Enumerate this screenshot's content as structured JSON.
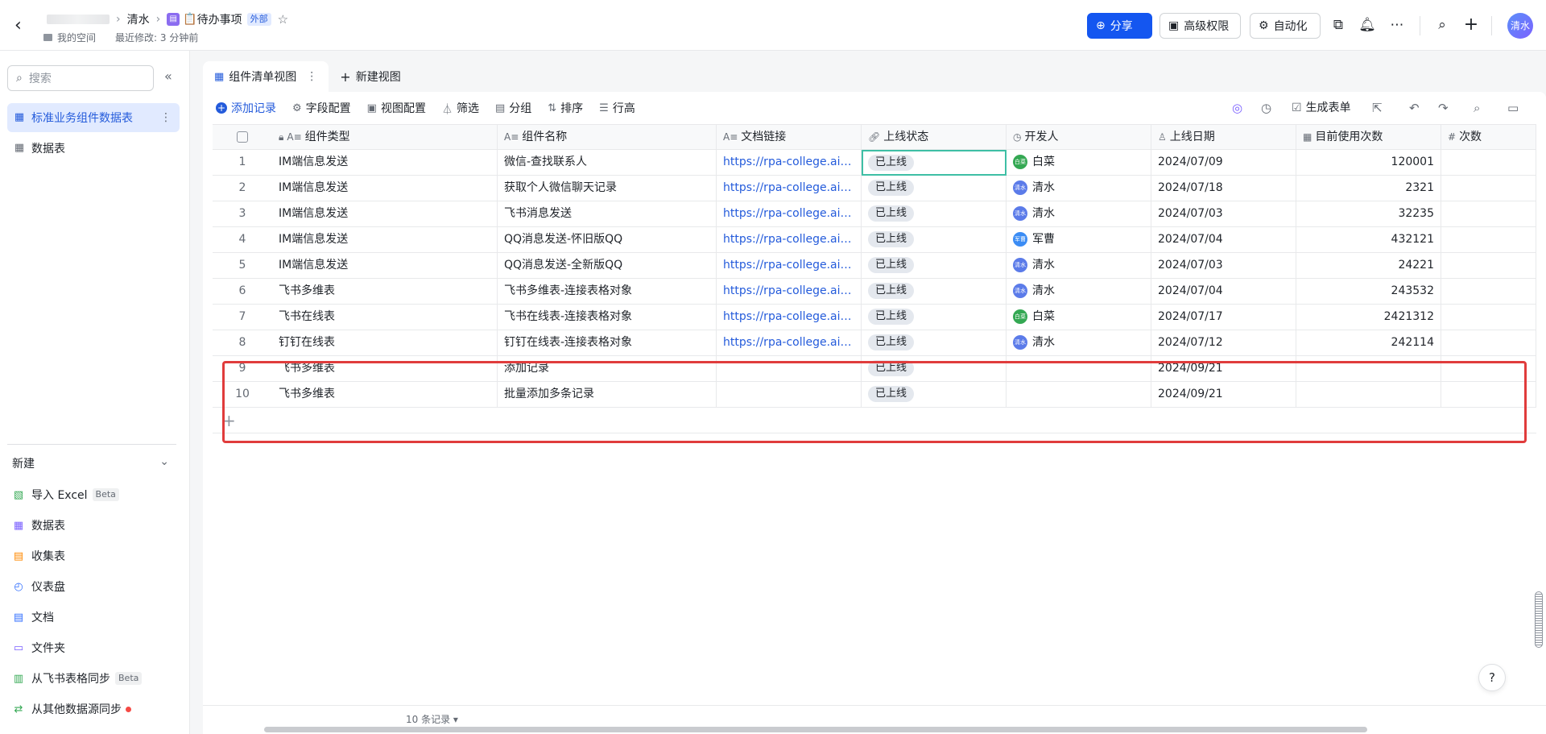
{
  "header": {
    "breadcrumb": {
      "parent": "清水",
      "doc_icon": "📋",
      "title": "待办事项",
      "badge": "外部"
    },
    "subline": {
      "space": "我的空间",
      "modified": "最近修改: 3 分钟前"
    },
    "buttons": {
      "share": "分享",
      "permission": "高级权限",
      "automation": "自动化"
    },
    "avatar": "清水"
  },
  "sidebar": {
    "search_placeholder": "搜索",
    "items": [
      {
        "label": "标准业务组件数据表",
        "active": true
      },
      {
        "label": "数据表",
        "active": false
      }
    ],
    "new_section": {
      "title": "新建",
      "items": [
        {
          "label": "导入 Excel",
          "badge": "Beta",
          "icon": "excel-icon",
          "color": "#34a853"
        },
        {
          "label": "数据表",
          "icon": "table-icon",
          "color": "#7b61ff"
        },
        {
          "label": "收集表",
          "icon": "form-icon",
          "color": "#ff8800"
        },
        {
          "label": "仪表盘",
          "icon": "dashboard-icon",
          "color": "#3370ff"
        },
        {
          "label": "文档",
          "icon": "doc-icon",
          "color": "#3370ff"
        },
        {
          "label": "文件夹",
          "icon": "folder-icon",
          "color": "#7b61ff"
        },
        {
          "label": "从飞书表格同步",
          "badge": "Beta",
          "icon": "sheet-sync-icon",
          "color": "#34a853"
        },
        {
          "label": "从其他数据源同步",
          "icon": "datasource-sync-icon",
          "color": "#34a853"
        }
      ]
    }
  },
  "tabs": [
    {
      "label": "组件清单视图",
      "active": true
    },
    {
      "label": "新建视图",
      "active": false
    }
  ],
  "toolbar": {
    "add_record": "添加记录",
    "field_config": "字段配置",
    "view_config": "视图配置",
    "filter": "筛选",
    "group": "分组",
    "sort": "排序",
    "row_height": "行高",
    "generate_form": "生成表单"
  },
  "table": {
    "columns": [
      "组件类型",
      "组件名称",
      "文档链接",
      "上线状态",
      "开发人",
      "上线日期",
      "目前使用次数",
      "次数"
    ],
    "rows": [
      {
        "idx": "1",
        "type": "IM端信息发送",
        "name": "微信-查找联系人",
        "link": "https://rpa-college.ai-in...",
        "status": "已上线",
        "dev": "白菜",
        "dev_short": "白菜",
        "dev_color": "green",
        "date": "2024/07/09",
        "count": "120001"
      },
      {
        "idx": "2",
        "type": "IM端信息发送",
        "name": "获取个人微信聊天记录",
        "link": "https://rpa-college.ai-in...",
        "status": "已上线",
        "dev": "清水",
        "dev_short": "清水",
        "dev_color": "blue",
        "date": "2024/07/18",
        "count": "2321"
      },
      {
        "idx": "3",
        "type": "IM端信息发送",
        "name": "飞书消息发送",
        "link": "https://rpa-college.ai-in...",
        "status": "已上线",
        "dev": "清水",
        "dev_short": "清水",
        "dev_color": "blue",
        "date": "2024/07/03",
        "count": "32235"
      },
      {
        "idx": "4",
        "type": "IM端信息发送",
        "name": "QQ消息发送-怀旧版QQ",
        "link": "https://rpa-college.ai-in...",
        "status": "已上线",
        "dev": "军曹",
        "dev_short": "军曹",
        "dev_color": "cyan",
        "date": "2024/07/04",
        "count": "432121"
      },
      {
        "idx": "5",
        "type": "IM端信息发送",
        "name": "QQ消息发送-全新版QQ",
        "link": "https://rpa-college.ai-in...",
        "status": "已上线",
        "dev": "清水",
        "dev_short": "清水",
        "dev_color": "blue",
        "date": "2024/07/03",
        "count": "24221"
      },
      {
        "idx": "6",
        "type": "飞书多维表",
        "name": "飞书多维表-连接表格对象",
        "link": "https://rpa-college.ai-in...",
        "status": "已上线",
        "dev": "清水",
        "dev_short": "清水",
        "dev_color": "blue",
        "date": "2024/07/04",
        "count": "243532"
      },
      {
        "idx": "7",
        "type": "飞书在线表",
        "name": "飞书在线表-连接表格对象",
        "link": "https://rpa-college.ai-in...",
        "status": "已上线",
        "dev": "白菜",
        "dev_short": "白菜",
        "dev_color": "green",
        "date": "2024/07/17",
        "count": "2421312"
      },
      {
        "idx": "8",
        "type": "钉钉在线表",
        "name": "钉钉在线表-连接表格对象",
        "link": "https://rpa-college.ai-in...",
        "status": "已上线",
        "dev": "清水",
        "dev_short": "清水",
        "dev_color": "blue",
        "date": "2024/07/12",
        "count": "242114"
      },
      {
        "idx": "9",
        "type": "飞书多维表",
        "name": "添加记录",
        "link": "",
        "status": "已上线",
        "dev": "",
        "dev_short": "",
        "dev_color": "",
        "date": "2024/09/21",
        "count": ""
      },
      {
        "idx": "10",
        "type": "飞书多维表",
        "name": "批量添加多条记录",
        "link": "",
        "status": "已上线",
        "dev": "",
        "dev_short": "",
        "dev_color": "",
        "date": "2024/09/21",
        "count": ""
      }
    ]
  },
  "footer": {
    "record_count": "10 条记录"
  },
  "colors": {
    "accent": "#1456f0",
    "highlight": "#e03c3c",
    "selected_cell": "#3ebfa5"
  }
}
